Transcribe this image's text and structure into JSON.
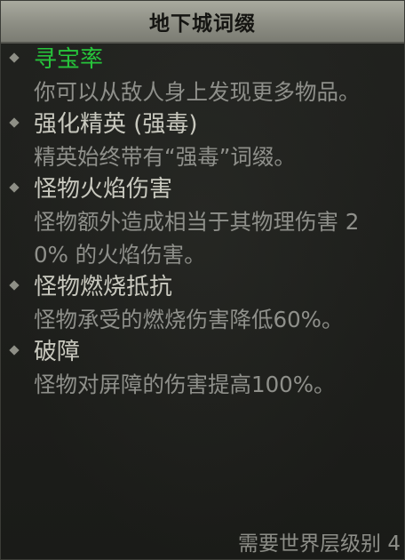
{
  "header": {
    "title": "地下城词缀"
  },
  "affixes": [
    {
      "name": "寻宝率",
      "description": "你可以从敌人身上发现更多物品。",
      "rarity_color": "#27c43b",
      "icon": "diamond-bullet-icon"
    },
    {
      "name": "强化精英 (强毒)",
      "description": "精英始终带有“强毒”词缀。",
      "rarity_color": "#c9c9bf",
      "icon": "diamond-bullet-icon"
    },
    {
      "name": "怪物火焰伤害",
      "description": "怪物额外造成相当于其物理伤害 20% 的火焰伤害。",
      "rarity_color": "#c9c9bf",
      "icon": "diamond-bullet-icon"
    },
    {
      "name": "怪物燃烧抵抗",
      "description": "怪物承受的燃烧伤害降低60%。",
      "rarity_color": "#c9c9bf",
      "icon": "diamond-bullet-icon"
    },
    {
      "name": "破障",
      "description": "怪物对屏障的伤害提高100%。",
      "rarity_color": "#c9c9bf",
      "icon": "diamond-bullet-icon"
    }
  ],
  "footer": {
    "requirement": "需要世界层级别 4"
  }
}
